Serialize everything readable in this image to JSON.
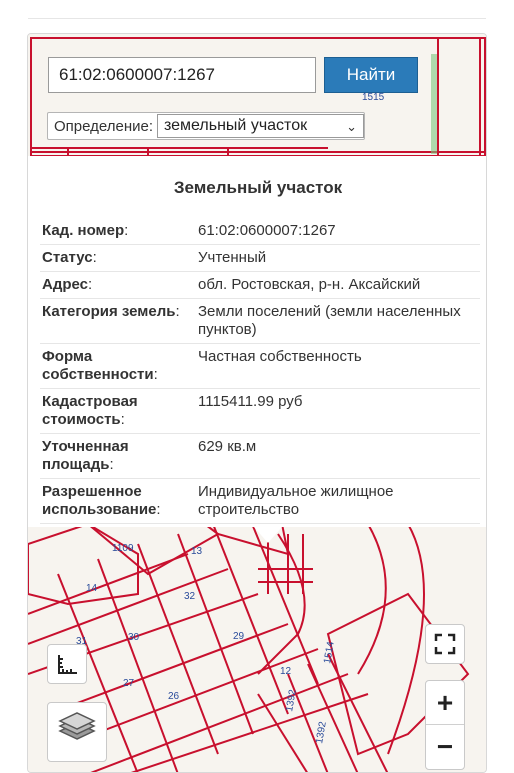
{
  "search": {
    "value": "61:02:0600007:1267",
    "button_label": "Найти"
  },
  "definition": {
    "label": "Определение:",
    "selected": "земельный участок"
  },
  "card": {
    "title": "Земельный участок",
    "rows": [
      {
        "key": "Кад. номер",
        "value": "61:02:0600007:1267"
      },
      {
        "key": "Статус",
        "value": "Учтенный"
      },
      {
        "key": "Адрес",
        "value": "обл. Ростовская, р-н. Аксайский"
      },
      {
        "key": "Категория земель",
        "value": "Земли поселений (земли населенных пунктов)"
      },
      {
        "key": "Форма собственности",
        "value": "Частная собственность"
      },
      {
        "key": "Кадастровая стоимость",
        "value": "1115411.99 руб"
      },
      {
        "key": "Уточненная площадь",
        "value": "629 кв.м"
      },
      {
        "key": "Разрешенное использование",
        "value": "Индивидуальное жилищное строительство"
      }
    ]
  },
  "map": {
    "labels": [
      "1515",
      "1109",
      "13",
      "14",
      "32",
      "31",
      "30",
      "29",
      "27",
      "26",
      "1514",
      "1392",
      "1392",
      "12"
    ],
    "parcel_color": "#c8102e",
    "icons": {
      "fullscreen": "fullscreen-icon",
      "ruler": "ruler-icon",
      "layers": "layers-icon"
    },
    "zoom": {
      "plus": "+",
      "minus": "−"
    }
  }
}
